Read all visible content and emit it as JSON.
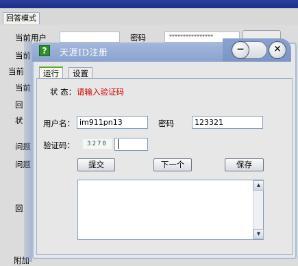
{
  "background": {
    "tab_label": "回答模式",
    "current_user_label": "当前用户",
    "password_label": "密码",
    "password_masked": "****************",
    "clipped_labels": [
      "当前",
      "当前",
      "当前",
      "回",
      "状",
      "问题",
      "问题",
      "回"
    ],
    "bottom_clipped": "附加"
  },
  "dialog": {
    "title": "天涯ID注册",
    "title_icon": "?",
    "minimize_glyph": "−",
    "close_glyph": "✕",
    "tabs": [
      {
        "label": "运行",
        "active": true
      },
      {
        "label": "设置",
        "active": false
      }
    ],
    "status_label": "状 态：",
    "status_value": "请输入验证码",
    "username_label": "用户名：",
    "username_value": "im911pn13",
    "password_label": "密码",
    "password_value": "123321",
    "captcha_label": "验证码：",
    "captcha_image_text": "3270",
    "captcha_input_value": "",
    "buttons": {
      "submit": "提交",
      "next": "下一个",
      "save": "保存"
    },
    "log_text": "",
    "scroll_up_glyph": "▲",
    "scroll_down_glyph": "▼"
  },
  "colors": {
    "status_red": "#d40000",
    "titlebar_blue": "#8aa2cf",
    "active_tab_green": "#5aaa2f"
  }
}
